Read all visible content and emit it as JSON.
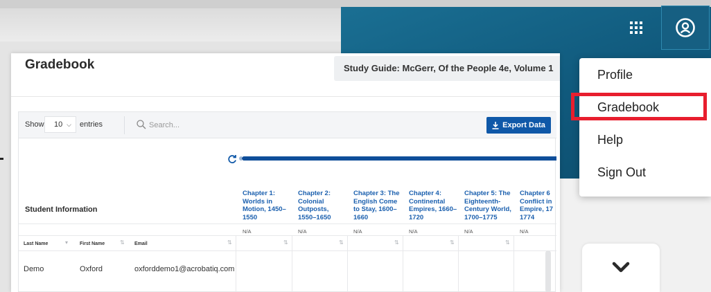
{
  "topbar": {
    "grid_icon": "grid-icon",
    "user_icon": "user-circle-icon"
  },
  "menu": {
    "items": [
      {
        "label": "Profile"
      },
      {
        "label": "Gradebook"
      },
      {
        "label": "Help"
      },
      {
        "label": "Sign Out"
      }
    ],
    "highlight_color": "#e81e2e"
  },
  "panel": {
    "title": "Gradebook",
    "study_guide": "Study Guide: McGerr, Of the People 4e, Volume 1"
  },
  "toolbar": {
    "show_label": "Show",
    "entries_value": "10",
    "entries_label": "entries",
    "search_placeholder": "Search...",
    "export_label": "Export Data"
  },
  "table": {
    "student_info_label": "Student Information",
    "chapters": [
      {
        "title": "Chapter 1: Worlds in Motion, 1450–1550",
        "score": "N/A"
      },
      {
        "title": "Chapter 2: Colonial Outposts, 1550–1650",
        "score": "N/A"
      },
      {
        "title": "Chapter 3: The English Come to Stay, 1600–1660",
        "score": "N/A"
      },
      {
        "title": "Chapter 4: Continental Empires, 1660–1720",
        "score": "N/A"
      },
      {
        "title": "Chapter 5: The Eighteenth-Century World, 1700–1775",
        "score": "N/A"
      },
      {
        "title": "Chapter 6 Conflict in Empire, 17 1774",
        "score": "N/A"
      }
    ],
    "columns": [
      "Last Name",
      "First Name",
      "Email"
    ],
    "rows": [
      {
        "last_name": "Demo",
        "first_name": "Oxford",
        "email": "oxforddemo1@acrobatiq.com"
      }
    ]
  },
  "colors": {
    "banner": "#10597c",
    "accent_blue": "#0f58a8",
    "chapter_link": "#1a5fae"
  }
}
